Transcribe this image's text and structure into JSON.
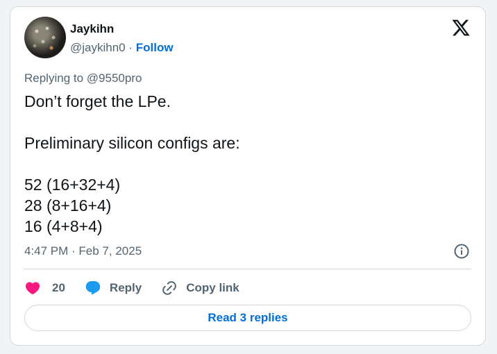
{
  "author": {
    "name": "Jaykihn",
    "handle": "@jaykihn0",
    "separator": "·",
    "follow_label": "Follow"
  },
  "tweet": {
    "reply_to": "Replying to @9550pro",
    "text": "Don’t forget the LPe.\n\nPreliminary silicon configs are:\n\n52 (16+32+4)\n28 (8+16+4)\n16 (4+8+4)",
    "timestamp": "4:47 PM · Feb 7, 2025"
  },
  "actions": {
    "like_count": "20",
    "reply_label": "Reply",
    "copy_link_label": "Copy link"
  },
  "read_replies_label": "Read 3 replies",
  "icons": {
    "logo": "x-logo-icon",
    "info": "info-icon",
    "like": "heart-icon",
    "reply": "speech-bubble-icon",
    "copy": "link-icon"
  },
  "colors": {
    "like": "#f91880",
    "reply": "#1d9bf0",
    "link": "#006fd6",
    "secondary_text": "#536471",
    "border": "#cfd9de"
  }
}
